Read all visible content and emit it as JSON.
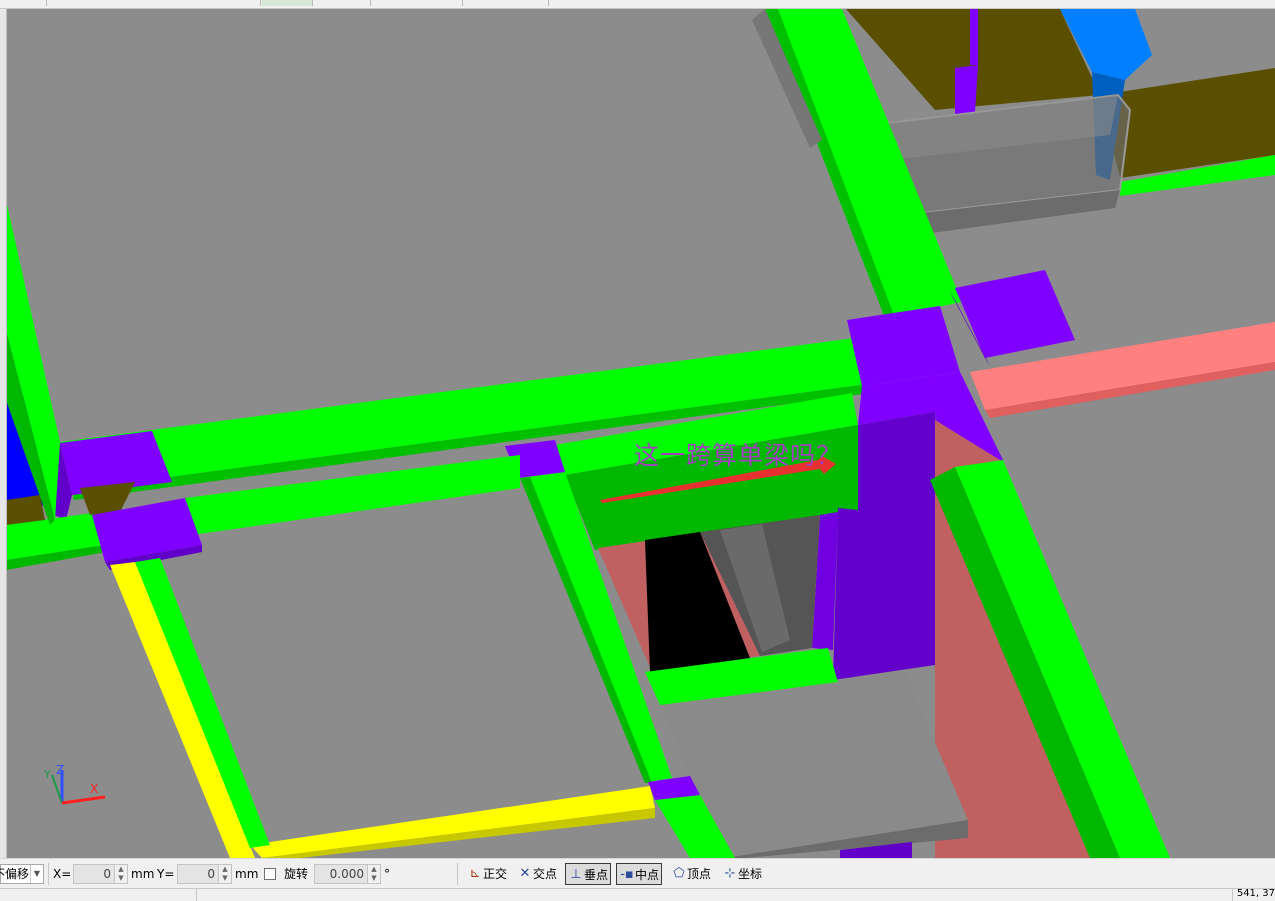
{
  "annotation": {
    "text": "这一跨算单梁吗？"
  },
  "axes_gizmo": {
    "x_label": "X",
    "y_label": "Y",
    "z_label": "Z"
  },
  "statusbar": {
    "offset_mode": "不偏移",
    "x_label": "X=",
    "x_value": "0",
    "x_unit": "mm",
    "y_label": "Y=",
    "y_value": "0",
    "y_unit": "mm",
    "rotate_label": "旋转",
    "rotate_value": "0.000",
    "rotate_unit": "°",
    "snaps": [
      {
        "label": "正交",
        "icon": "ortho-icon",
        "active": false
      },
      {
        "label": "交点",
        "icon": "intersection-icon",
        "active": false
      },
      {
        "label": "垂点",
        "icon": "perpendicular-icon",
        "active": true
      },
      {
        "label": "中点",
        "icon": "midpoint-icon",
        "active": true
      },
      {
        "label": "顶点",
        "icon": "vertex-icon",
        "active": false
      },
      {
        "label": "坐标",
        "icon": "coordinate-icon",
        "active": false
      }
    ]
  },
  "bottom": {
    "coords": "541, 37"
  },
  "colors": {
    "slab": "#8c8c8c",
    "beam_green": "#00ff00",
    "beam_green_side": "#00b800",
    "column_purple": "#8000ff",
    "column_purple_side": "#6000c8",
    "beam_yellow": "#ffff00",
    "beam_pink": "#ff8080",
    "wall_salmon": "#c06060",
    "beam_blue": "#0080ff",
    "olive": "#5a4f00",
    "arrow_red": "#e83030"
  }
}
